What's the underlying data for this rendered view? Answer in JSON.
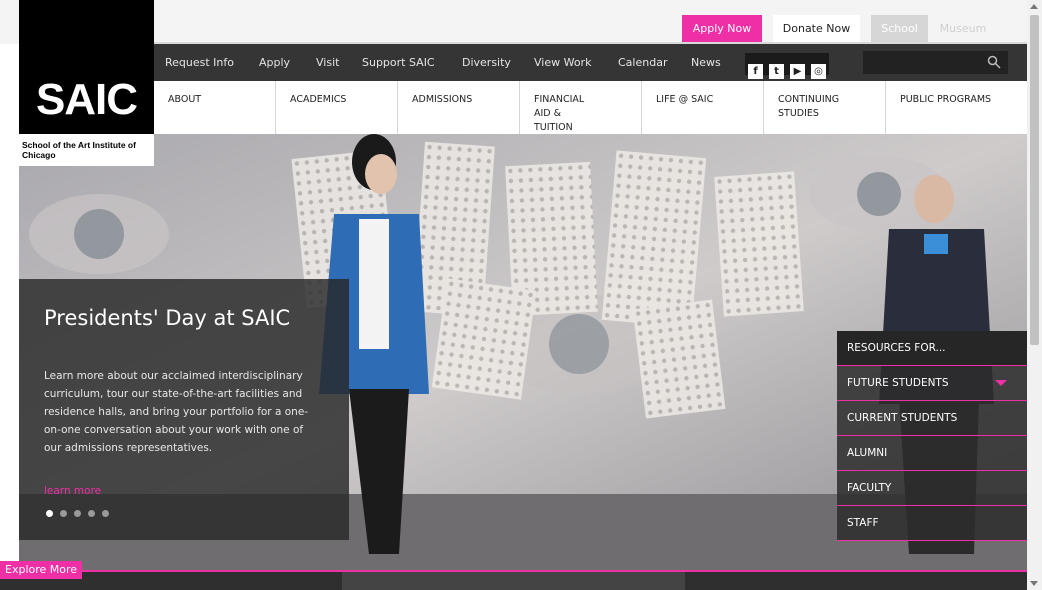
{
  "topbar": {
    "apply_now": "Apply Now",
    "donate_now": "Donate Now",
    "school_tab": "School",
    "museum_tab": "Museum"
  },
  "utility_nav": [
    {
      "label": "Request Info"
    },
    {
      "label": "Apply"
    },
    {
      "label": "Visit"
    },
    {
      "label": "Support SAIC"
    },
    {
      "label": "Diversity"
    },
    {
      "label": "View Work"
    },
    {
      "label": "Calendar"
    },
    {
      "label": "News"
    }
  ],
  "social": [
    "facebook-icon",
    "twitter-icon",
    "youtube-icon",
    "instagram-icon"
  ],
  "search": {
    "placeholder": ""
  },
  "logo": {
    "main": "SAIC",
    "sub": "School of the Art Institute of Chicago"
  },
  "main_nav": [
    {
      "label": "ABOUT"
    },
    {
      "label": "ACADEMICS"
    },
    {
      "label": "ADMISSIONS"
    },
    {
      "label": "FINANCIAL AID & TUITION"
    },
    {
      "label": "LIFE @ SAIC"
    },
    {
      "label": "CONTINUING STUDIES"
    },
    {
      "label": "PUBLIC PROGRAMS"
    }
  ],
  "slide": {
    "title": "Presidents' Day at SAIC",
    "body": "Learn more about our acclaimed interdisciplinary curriculum, tour our state-of-the-art facilities and residence halls, and bring your portfolio for a one-on-one conversation about your work with one of our admissions representatives.",
    "link": "learn more",
    "dot_count": 5,
    "active_dot": 1
  },
  "resources": {
    "heading": "RESOURCES FOR...",
    "items": [
      {
        "label": "FUTURE STUDENTS"
      },
      {
        "label": "CURRENT STUDENTS"
      },
      {
        "label": "ALUMNI"
      },
      {
        "label": "FACULTY"
      },
      {
        "label": "STAFF"
      }
    ]
  },
  "explore": "Explore More",
  "colors": {
    "accent": "#ee2fa5",
    "dark": "#353535"
  }
}
